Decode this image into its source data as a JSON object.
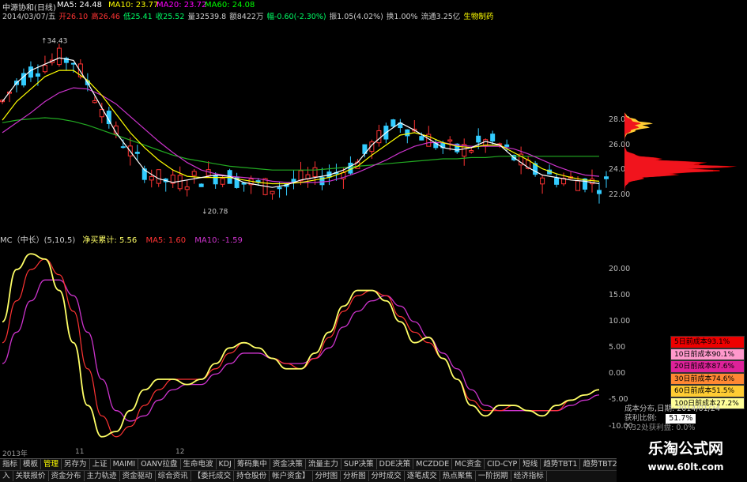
{
  "header": {
    "title": "中源协和(日线)",
    "ma": [
      {
        "label": "MA5: 24.48",
        "color": "#ffffff"
      },
      {
        "label": "MA10: 23.77",
        "color": "#ffff00"
      },
      {
        "label": "MA20: 23.72",
        "color": "#ff00ff"
      },
      {
        "label": "MA60: 24.08",
        "color": "#00ff00"
      }
    ],
    "quote": [
      {
        "text": "2014/03/07/五",
        "color": "#cccccc"
      },
      {
        "text": "开26.10",
        "color": "#ff3333"
      },
      {
        "text": "高26.46",
        "color": "#ff3333"
      },
      {
        "text": "低25.41",
        "color": "#00ff66"
      },
      {
        "text": "收25.52",
        "color": "#00ff66"
      },
      {
        "text": "量32539.8",
        "color": "#cccccc"
      },
      {
        "text": "额8422万",
        "color": "#cccccc"
      },
      {
        "text": "幅-0.60(-2.30%)",
        "color": "#00ff66"
      },
      {
        "text": "振1.05(4.02%)",
        "color": "#cccccc"
      },
      {
        "text": "换1.00%",
        "color": "#cccccc"
      },
      {
        "text": "流通3.25亿",
        "color": "#cccccc"
      },
      {
        "text": "生物制药",
        "color": "#ffff00"
      }
    ],
    "high_label": "34.43",
    "low_label": "20.78"
  },
  "indicator": {
    "name": "MC（中长）(5,10,5)",
    "net_label": "净买累计: 5.56",
    "ma5": "MA5: 1.60",
    "ma10": "MA10: -1.59",
    "colors": {
      "net": "#ffff66",
      "ma5": "#ff3333",
      "ma10": "#cc33cc"
    }
  },
  "price_axis": [
    "28.00",
    "26.00",
    "24.00",
    "22.00"
  ],
  "ind_axis": [
    "20.00",
    "15.00",
    "10.00",
    "5.00",
    "0.00",
    "-5.00",
    "-10.00"
  ],
  "cost_legend": [
    {
      "label": "5日前成本93.1%",
      "bg": "#ee0000"
    },
    {
      "label": "10日前成本90.1%",
      "bg": "#ff99cc"
    },
    {
      "label": "20日前成本87.6%",
      "bg": "#dd2299"
    },
    {
      "label": "30日前成本74.6%",
      "bg": "#ff8833"
    },
    {
      "label": "60日前成本51.5%",
      "bg": "#ffcc33"
    },
    {
      "label": "100日前成本27.2%",
      "bg": "#ffff99"
    }
  ],
  "cost_info": {
    "date_label": "成本分布,日期:",
    "date_value": "2014/01/24",
    "profit_label": "获利比例:",
    "profit_value": "51.7%",
    "bottom_line": "7.32处获利盘: 0.0%"
  },
  "time_axis": [
    "2013年",
    "11",
    "12"
  ],
  "tabs_row1": [
    "指标",
    "模板",
    "管理",
    "另存为",
    "上证",
    "MAIMI",
    "OANV拉盘",
    "生命电波",
    "KDJ",
    "筹码集中",
    "资金决策",
    "流量主力",
    "SUP决策",
    "DDE决策",
    "MCZDDE",
    "MC资金",
    "CID-CYP",
    "短线",
    "趋势TBT1",
    "趋势TBT2",
    "行业IC1",
    "行业IC2",
    "▶"
  ],
  "tabs_row2": [
    "入",
    "关联报价",
    "资金分布",
    "主力轨迹",
    "资金驱动",
    "综合资讯",
    "【委托成交",
    "持仓股份",
    "帐户资金】",
    "分时图",
    "分析图",
    "分时成交",
    "逐笔成交",
    "热点聚焦",
    "一阶拐期",
    "经济指标"
  ],
  "active_tab": "管理",
  "watermark": {
    "title": "乐淘公式网",
    "url": "www.60lt.com"
  },
  "chart_data": {
    "type": "line",
    "price_panel": {
      "ylim": [
        19,
        36
      ],
      "ma5": [
        29.5,
        31,
        32,
        32.5,
        33,
        32.8,
        31,
        29,
        27,
        25.5,
        24,
        23.3,
        23,
        23.2,
        23.4,
        23.6,
        23.5,
        23,
        22.8,
        22.6,
        22.8,
        23.2,
        23.4,
        23.6,
        24,
        24.6,
        26,
        27,
        27.8,
        27.2,
        26.5,
        25.8,
        25.6,
        25.8,
        26.3,
        26,
        25,
        24.2,
        23.6,
        23.4,
        23.2,
        23.1,
        22.9
      ],
      "ma10": [
        28,
        29.5,
        30.5,
        31.5,
        32,
        32,
        31.2,
        30,
        28.5,
        27,
        25.8,
        24.8,
        24,
        23.5,
        23.4,
        23.4,
        23.4,
        23.2,
        23,
        22.9,
        22.9,
        23,
        23.2,
        23.4,
        23.8,
        24.3,
        25.2,
        26,
        26.8,
        27,
        26.7,
        26.2,
        25.9,
        25.8,
        26,
        26,
        25.4,
        24.8,
        24.1,
        23.7,
        23.4,
        23.2,
        23.1
      ],
      "ma20": [
        27,
        27.8,
        28.6,
        29.5,
        30.2,
        30.6,
        30.5,
        30,
        29.3,
        28.3,
        27.3,
        26.3,
        25.4,
        24.6,
        24,
        23.7,
        23.5,
        23.4,
        23.3,
        23.1,
        23,
        23,
        23,
        23.1,
        23.4,
        23.8,
        24.3,
        24.8,
        25.4,
        25.9,
        26.2,
        26.2,
        26,
        25.9,
        25.9,
        25.9,
        25.7,
        25.3,
        24.8,
        24.3,
        23.9,
        23.6,
        23.5
      ],
      "ma60": [
        27.8,
        28,
        28.1,
        28.2,
        28.1,
        27.9,
        27.6,
        27.2,
        26.8,
        26.4,
        26,
        25.6,
        25.2,
        24.9,
        24.7,
        24.5,
        24.3,
        24.2,
        24.1,
        24,
        24,
        24,
        24,
        24.1,
        24.2,
        24.3,
        24.4,
        24.5,
        24.6,
        24.7,
        24.8,
        24.9,
        24.9,
        25,
        25,
        25.1,
        25.1,
        25.1,
        25.1,
        25.1,
        25.1,
        25.1,
        25.1
      ]
    },
    "indicator_panel": {
      "ylim": [
        -14,
        25
      ],
      "net": [
        10,
        20,
        23,
        22,
        16,
        6,
        -6,
        -12,
        -11,
        -7,
        -3,
        -1,
        -1,
        -2,
        -1,
        2,
        5,
        6,
        5,
        3,
        1,
        1,
        4,
        8,
        13,
        16,
        16,
        14,
        10,
        6,
        7,
        3,
        -1,
        -6,
        -8,
        -6,
        -6,
        -7,
        -8,
        -6,
        -5,
        -4,
        -3
      ],
      "ma5": [
        6,
        14,
        20,
        22,
        19,
        12,
        1,
        -8,
        -12,
        -10,
        -6,
        -3,
        -1,
        -1,
        -1,
        1,
        4,
        6,
        5,
        3,
        2,
        1,
        3,
        7,
        12,
        15,
        16,
        15,
        11,
        8,
        6,
        3,
        -1,
        -5,
        -7,
        -7,
        -6,
        -7,
        -7,
        -7,
        -5,
        -4,
        -3
      ],
      "ma10": [
        2,
        8,
        14,
        18,
        18,
        15,
        8,
        -1,
        -7,
        -9,
        -8,
        -5,
        -3,
        -2,
        -2,
        0,
        2,
        4,
        4,
        3,
        2,
        2,
        3,
        5,
        9,
        12,
        14,
        15,
        13,
        10,
        7,
        4,
        1,
        -3,
        -6,
        -7,
        -7,
        -7,
        -7,
        -7,
        -6,
        -5,
        -4
      ]
    }
  }
}
